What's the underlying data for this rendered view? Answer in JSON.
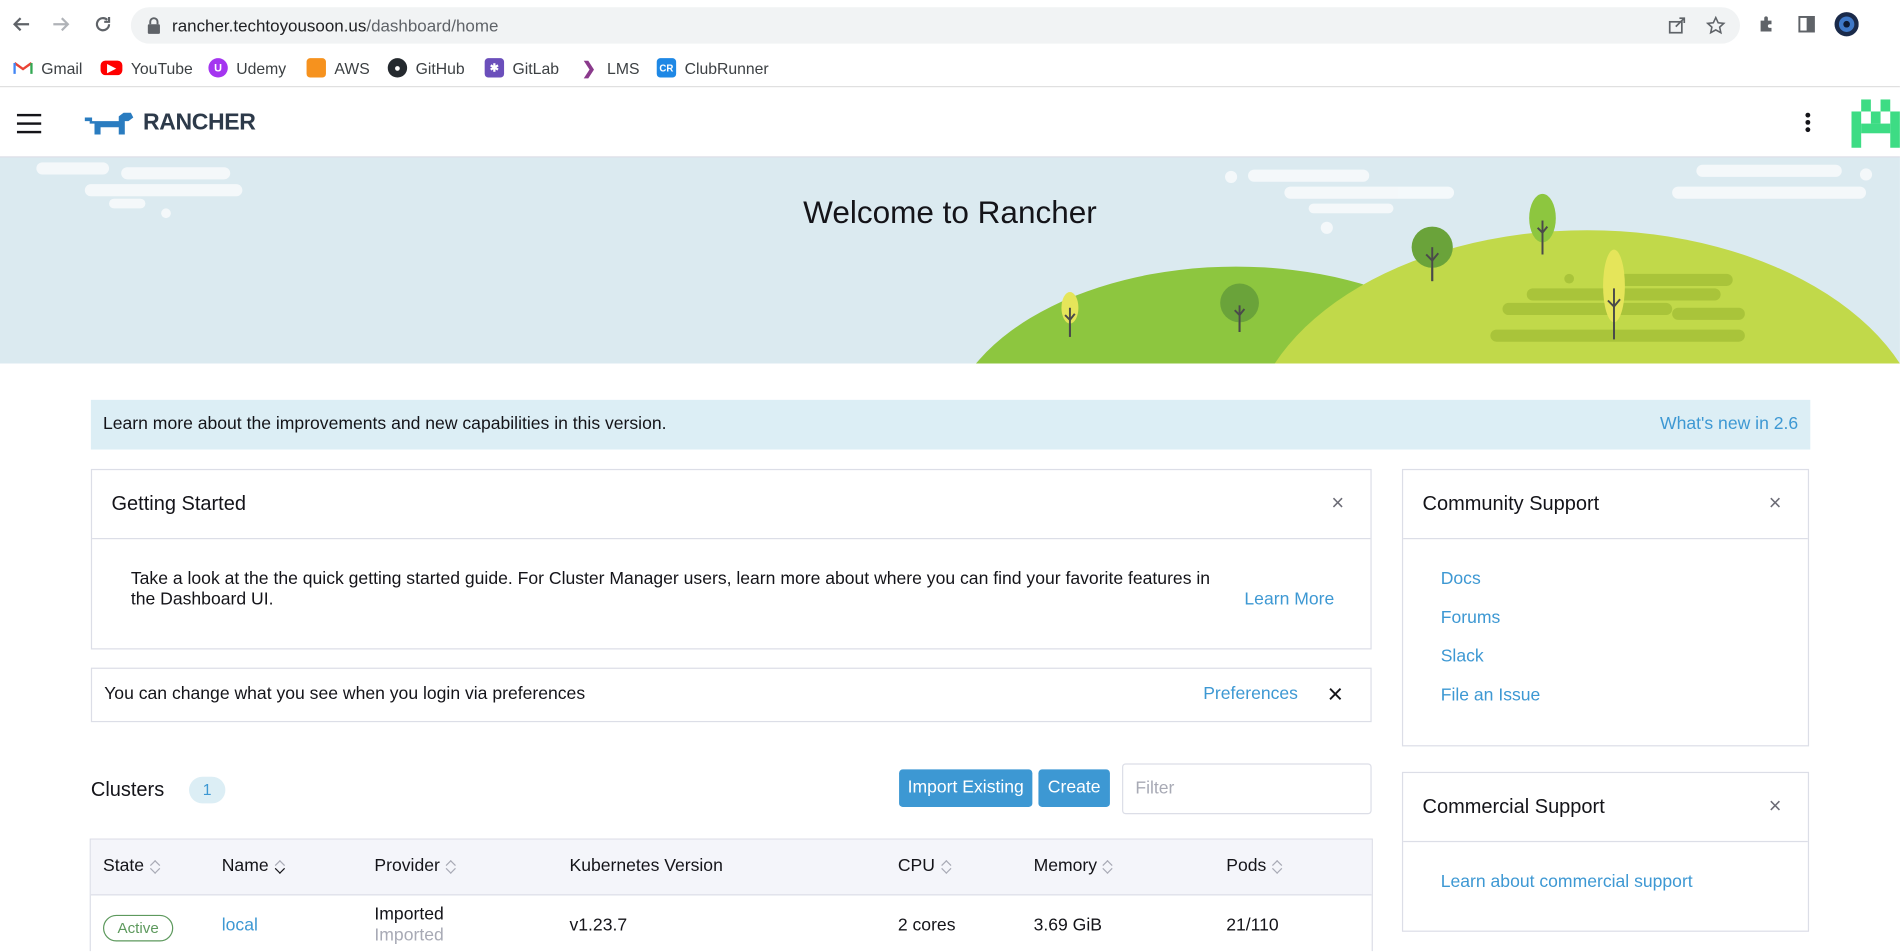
{
  "browser": {
    "url_domain": "rancher.techtoyousoon.us",
    "url_path": "/dashboard/home",
    "bookmarks": [
      {
        "label": "Gmail",
        "icon": "gmail-icon"
      },
      {
        "label": "YouTube",
        "icon": "youtube-icon"
      },
      {
        "label": "Udemy",
        "icon": "udemy-icon"
      },
      {
        "label": "AWS",
        "icon": "aws-icon"
      },
      {
        "label": "GitHub",
        "icon": "github-icon"
      },
      {
        "label": "GitLab",
        "icon": "gitlab-icon"
      },
      {
        "label": "LMS",
        "icon": "lms-icon"
      },
      {
        "label": "ClubRunner",
        "icon": "clubrunner-icon"
      }
    ]
  },
  "header": {
    "logo_text": "RANCHER"
  },
  "banner": {
    "title": "Welcome to Rancher"
  },
  "notice": {
    "text": "Learn more about the improvements and new capabilities in this version.",
    "link": "What's new in 2.6"
  },
  "getting_started": {
    "title": "Getting Started",
    "text": "Take a look at the the quick getting started guide. For Cluster Manager users, learn more about where you can find your favorite features in the Dashboard UI.",
    "link": "Learn More"
  },
  "preferences": {
    "text": "You can change what you see when you login via preferences",
    "link": "Preferences"
  },
  "community_support": {
    "title": "Community Support",
    "links": [
      "Docs",
      "Forums",
      "Slack",
      "File an Issue"
    ]
  },
  "commercial_support": {
    "title": "Commercial Support",
    "link": "Learn about commercial support"
  },
  "clusters": {
    "label": "Clusters",
    "count": "1",
    "import_button": "Import Existing",
    "create_button": "Create",
    "filter_placeholder": "Filter",
    "columns": [
      "State",
      "Name",
      "Provider",
      "Kubernetes Version",
      "CPU",
      "Memory",
      "Pods"
    ],
    "rows": [
      {
        "state": "Active",
        "name": "local",
        "provider": "Imported",
        "provider_sub": "Imported",
        "k8s_version": "v1.23.7",
        "cpu": "2 cores",
        "memory": "3.69 GiB",
        "pods": "21/110"
      }
    ]
  },
  "colors": {
    "accent": "#3d98d3",
    "active_state": "#5d995d",
    "banner_sky": "#dbeaf0",
    "hill_light": "#c1d94a",
    "hill_dark": "#8dc63f"
  }
}
